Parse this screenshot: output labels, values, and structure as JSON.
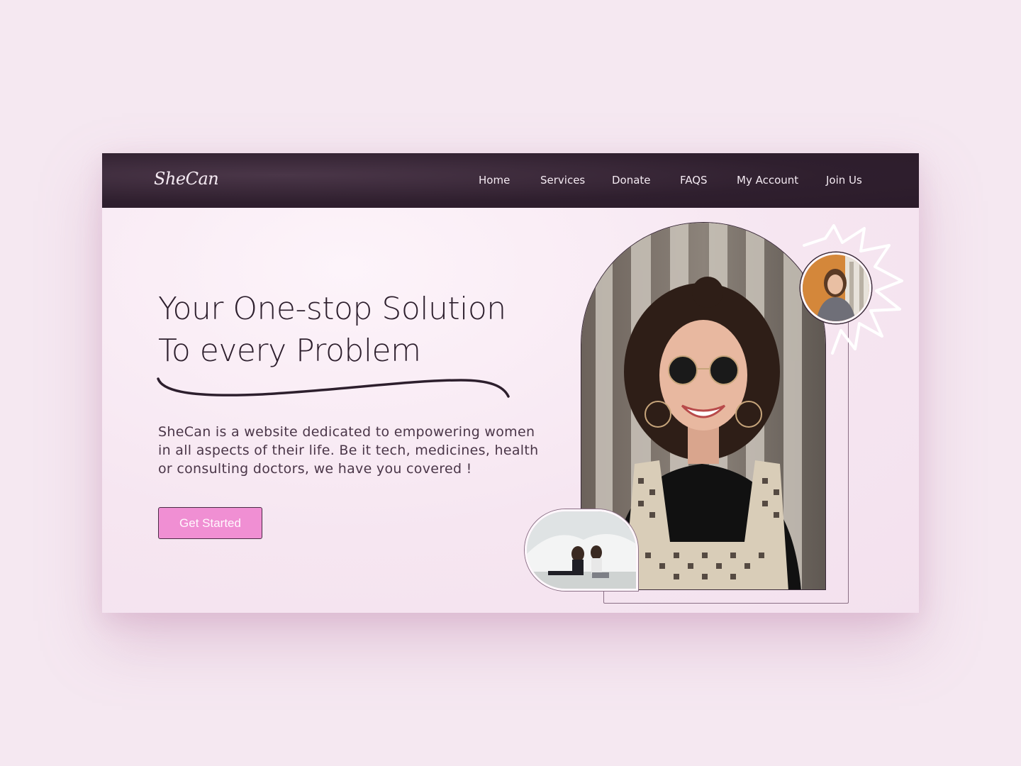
{
  "brand": {
    "logo": "SheCan"
  },
  "nav": {
    "items": [
      {
        "label": "Home"
      },
      {
        "label": "Services"
      },
      {
        "label": "Donate"
      },
      {
        "label": "FAQS"
      },
      {
        "label": "My Account"
      },
      {
        "label": "Join Us"
      }
    ]
  },
  "hero": {
    "headline_line1": "Your One-stop Solution",
    "headline_line2": "To every Problem",
    "description_line1": "SheCan is a website dedicated to empowering women",
    "description_line2": "in all aspects of their life. Be it tech, medicines, health",
    "description_line3": "or consulting doctors, we have you covered !",
    "cta_label": "Get Started"
  },
  "colors": {
    "page_bg": "#f5e8f1",
    "navbar_bg": "#2f1f2e",
    "accent": "#f08fd3",
    "heading": "#2d1f2d",
    "body_text": "#4a3648"
  },
  "images": {
    "main_photo": "smiling-woman-sunglasses-photo",
    "top_avatar": "woman-portrait-avatar",
    "bottom_bubble": "two-women-sitting-photo"
  }
}
